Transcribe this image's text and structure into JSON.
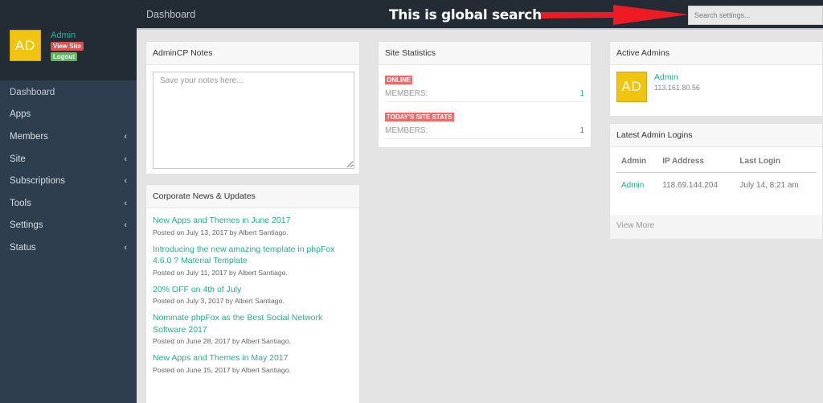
{
  "sidebar": {
    "avatar_initials": "AD",
    "user_name": "Admin",
    "view_site_label": "View Site",
    "logout_label": "Logout",
    "items": [
      {
        "label": "Dashboard",
        "has_submenu": false
      },
      {
        "label": "Apps",
        "has_submenu": false
      },
      {
        "label": "Members",
        "has_submenu": true
      },
      {
        "label": "Site",
        "has_submenu": true
      },
      {
        "label": "Subscriptions",
        "has_submenu": true
      },
      {
        "label": "Tools",
        "has_submenu": true
      },
      {
        "label": "Settings",
        "has_submenu": true
      },
      {
        "label": "Status",
        "has_submenu": true
      }
    ],
    "chevron": "‹"
  },
  "header": {
    "title": "Dashboard",
    "annotation": "This is global search",
    "search_placeholder": "Search settings..."
  },
  "notes": {
    "title": "AdminCP Notes",
    "placeholder": "Save your notes here..."
  },
  "news": {
    "title": "Corporate News & Updates",
    "items": [
      {
        "title": "New Apps and Themes in June 2017",
        "meta": "Posted on July 13, 2017 by Albert Santiago."
      },
      {
        "title": "Introducing the new amazing template in phpFox 4.6.0 ? Material Template",
        "meta": "Posted on July 11, 2017 by Albert Santiago."
      },
      {
        "title": "20% OFF on 4th of July",
        "meta": "Posted on July 3, 2017 by Albert Santiago."
      },
      {
        "title": "Nominate phpFox as the Best Social Network Software 2017",
        "meta": "Posted on June 28, 2017 by Albert Santiago."
      },
      {
        "title": "New Apps and Themes in May 2017",
        "meta": "Posted on June 15, 2017 by Albert Santiago."
      }
    ]
  },
  "stats": {
    "title": "Site Statistics",
    "blocks": [
      {
        "label": "ONLINE",
        "row_label": "MEMBERS:",
        "value": "1"
      },
      {
        "label": "TODAY'S SITE STATS",
        "row_label": "MEMBERS:",
        "value": "1"
      }
    ]
  },
  "active_admins": {
    "title": "Active Admins",
    "avatar_initials": "AD",
    "name": "Admin",
    "ip": "113.161.80.56"
  },
  "logins": {
    "title": "Latest Admin Logins",
    "columns": [
      "Admin",
      "IP Address",
      "Last Login"
    ],
    "rows": [
      {
        "admin": "Admin",
        "ip": "118.69.144.204",
        "last_login": "July 14, 8:21 am"
      }
    ],
    "view_more": "View More"
  },
  "colors": {
    "accent": "#1abc9c",
    "avatar": "#f1c40f",
    "sidebar": "#2f3e4e",
    "topbar": "#232b34",
    "badge_red": "#f06a6a",
    "annotation_arrow": "#ed1c24"
  }
}
